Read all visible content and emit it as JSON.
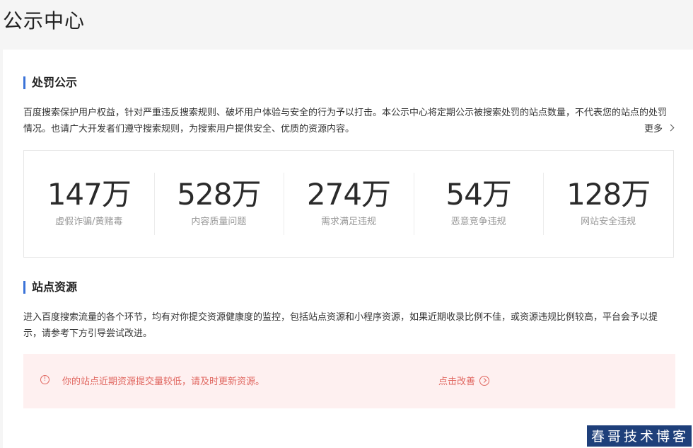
{
  "page": {
    "title": "公示中心"
  },
  "penalty": {
    "title": "处罚公示",
    "description": "百度搜索保护用户权益，针对严重违反搜索规则、破坏用户体验与安全的行为予以打击。本公示中心将定期公示被搜索处罚的站点数量，不代表您的站点的处罚情况。也请广大开发者们遵守搜索规则，为搜索用户提供安全、优质的资源内容。",
    "more_label": "更多",
    "stats": [
      {
        "value": "147万",
        "label": "虚假诈骗/黄赌毒"
      },
      {
        "value": "528万",
        "label": "内容质量问题"
      },
      {
        "value": "274万",
        "label": "需求满足违规"
      },
      {
        "value": "54万",
        "label": "恶意竞争违规"
      },
      {
        "value": "128万",
        "label": "网站安全违规"
      }
    ]
  },
  "resources": {
    "title": "站点资源",
    "description": "进入百度搜索流量的各个环节，均有对你提交资源健康度的监控，包括站点资源和小程序资源，如果近期收录比例不佳，或资源违规比例较高，平台会予以提示，请参考下方引导尝试改进。",
    "alert": {
      "text": "你的站点近期资源提交量较低，请及时更新资源。",
      "action_label": "点击改善",
      "color": "#e0665f",
      "background": "#fef0f0"
    }
  },
  "watermark": {
    "text": "春哥技术博客"
  },
  "colors": {
    "accent": "#3b73d8"
  }
}
